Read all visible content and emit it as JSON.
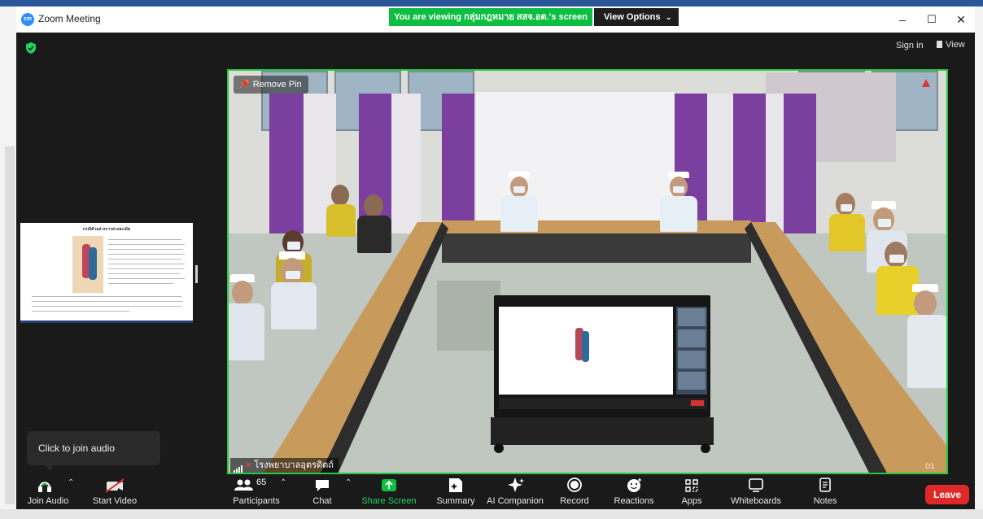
{
  "window": {
    "app_title": "Zoom Meeting"
  },
  "banner": {
    "viewing_text": "You are viewing กลุ่มกฎหมาย สสจ.อต.'s screen",
    "view_options_label": "View Options"
  },
  "header": {
    "sign_in_label": "Sign in",
    "view_label": "View"
  },
  "video": {
    "remove_pin_label": "Remove Pin",
    "speaker_name": "โรงพยาบาลอุตรดิตถ์",
    "corner_tag": "D1"
  },
  "shared_doc": {
    "title": "กรณีตัวอย่างการล่วงละเมิด"
  },
  "tooltip": {
    "text": "Click to join audio"
  },
  "toolbar": {
    "join_audio_label": "Join Audio",
    "start_video_label": "Start Video",
    "participants_label": "Participants",
    "participants_count": "65",
    "chat_label": "Chat",
    "share_screen_label": "Share Screen",
    "summary_label": "Summary",
    "ai_companion_label": "AI Companion",
    "record_label": "Record",
    "reactions_label": "Reactions",
    "apps_label": "Apps",
    "whiteboards_label": "Whiteboards",
    "notes_label": "Notes",
    "leave_label": "Leave"
  },
  "colors": {
    "share_green": "#0ebe42",
    "leave_red": "#e02828",
    "pin_border": "#28c840",
    "toolbar_bg": "#1a1a1a"
  }
}
